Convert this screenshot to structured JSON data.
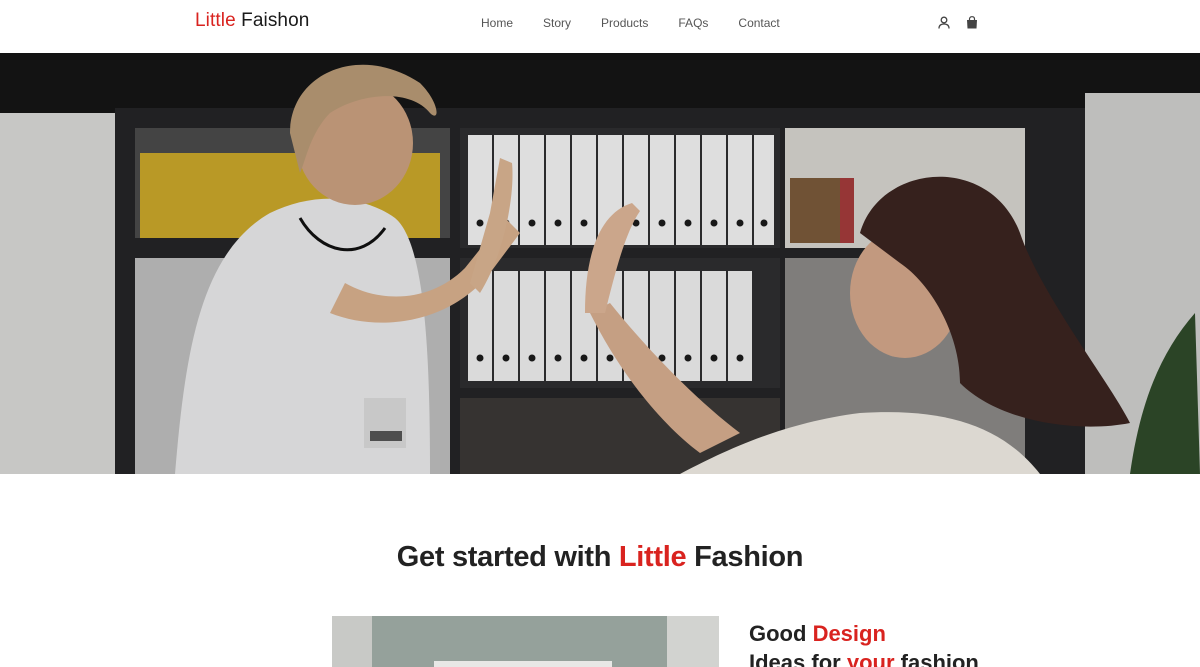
{
  "brand": {
    "part1": "Little",
    "part2": "Faishon",
    "accent_color": "#d9231f"
  },
  "nav": {
    "links": [
      "Home",
      "Story",
      "Products",
      "FAQs",
      "Contact"
    ],
    "icons": [
      "user-icon",
      "shopping-bag-icon"
    ]
  },
  "hero": {
    "description_icon": "hero-photo"
  },
  "section": {
    "title_part1": "Get started with",
    "title_accent": "Little",
    "title_part2": "Fashion"
  },
  "feature": {
    "line1_part1": "Good",
    "line1_accent": "Design",
    "line2_part1": "Ideas for",
    "line2_accent": "your",
    "line2_part2": "fashion"
  }
}
